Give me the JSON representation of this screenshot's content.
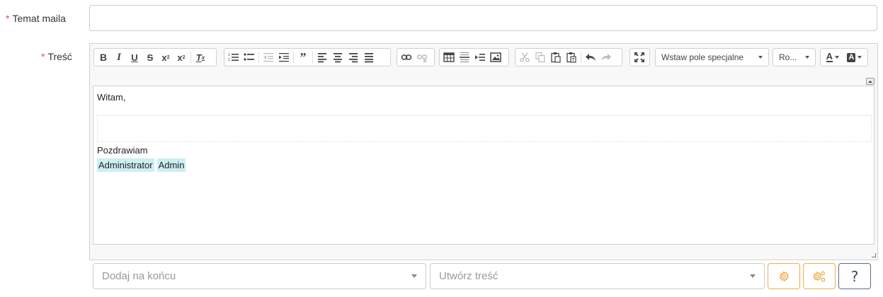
{
  "form": {
    "required_mark": "*",
    "subject_label": "Temat maila",
    "subject_value": "",
    "body_label": "Treść"
  },
  "toolbar": {
    "bold": "B",
    "italic": "I",
    "underline": "U",
    "strike": "S",
    "subscript": "x",
    "superscript": "x",
    "sub_mark": "2",
    "sup_mark": "2",
    "remove_format": "T",
    "remove_mark": "x",
    "special_field_combo": "Wstaw pole specjalne",
    "font_combo": "Ro...",
    "text_color": "A",
    "bg_color": "A"
  },
  "editor": {
    "greeting": "Witam,",
    "closing": "Pozdrawiam",
    "signature": [
      "Administrator",
      "Admin"
    ]
  },
  "bottom": {
    "append_placeholder": "Dodaj na końcu",
    "create_placeholder": "Utwórz treść",
    "help_glyph": "?"
  },
  "colors": {
    "accent_warning": "#f0ad4e",
    "required": "#d9534f",
    "chip_bg": "#cdeef2",
    "help_border": "#5a6d84"
  }
}
